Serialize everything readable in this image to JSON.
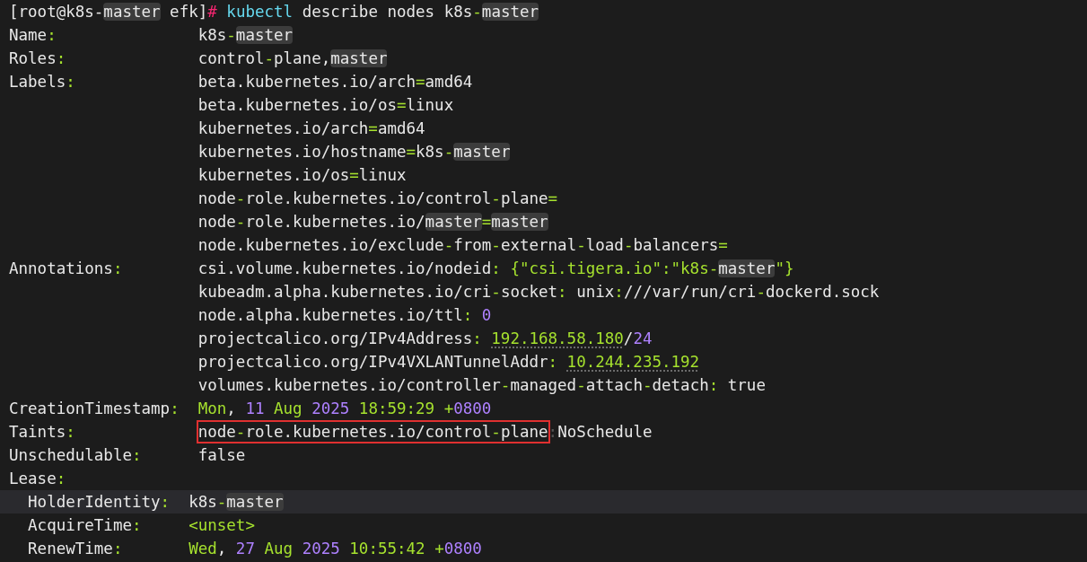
{
  "prompt": [
    {
      "text": "[root@k8s-",
      "kind": "plain"
    },
    {
      "text": "master",
      "kind": "match"
    },
    {
      "text": " efk]",
      "kind": "plain"
    },
    {
      "text": "#",
      "kind": "sign"
    },
    {
      "text": " kubectl",
      "kind": "command"
    },
    {
      "text": " describe nodes k8s",
      "kind": "plain"
    },
    {
      "text": "-",
      "kind": "punct"
    },
    {
      "text": "master",
      "kind": "match"
    }
  ],
  "lines": [
    {
      "current": false,
      "key": [
        {
          "text": "Name",
          "kind": "plain"
        },
        {
          "text": ":",
          "kind": "punct"
        }
      ],
      "value": [
        {
          "text": "k8s",
          "kind": "plain"
        },
        {
          "text": "-",
          "kind": "punct"
        },
        {
          "text": "master",
          "kind": "match"
        }
      ]
    },
    {
      "current": false,
      "key": [
        {
          "text": "Roles",
          "kind": "plain"
        },
        {
          "text": ":",
          "kind": "punct"
        }
      ],
      "value": [
        {
          "text": "control",
          "kind": "plain"
        },
        {
          "text": "-",
          "kind": "punct"
        },
        {
          "text": "plane,",
          "kind": "plain"
        },
        {
          "text": "master",
          "kind": "match"
        }
      ]
    },
    {
      "current": false,
      "key": [
        {
          "text": "Labels",
          "kind": "plain"
        },
        {
          "text": ":",
          "kind": "punct"
        }
      ],
      "value": [
        {
          "text": "beta.kubernetes.io/arch",
          "kind": "plain"
        },
        {
          "text": "=",
          "kind": "punct"
        },
        {
          "text": "amd64",
          "kind": "plain"
        }
      ]
    },
    {
      "current": false,
      "value": [
        {
          "text": "beta.kubernetes.io/os",
          "kind": "plain"
        },
        {
          "text": "=",
          "kind": "punct"
        },
        {
          "text": "linux",
          "kind": "plain"
        }
      ]
    },
    {
      "current": false,
      "value": [
        {
          "text": "kubernetes.io/arch",
          "kind": "plain"
        },
        {
          "text": "=",
          "kind": "punct"
        },
        {
          "text": "amd64",
          "kind": "plain"
        }
      ]
    },
    {
      "current": false,
      "value": [
        {
          "text": "kubernetes.io/hostname",
          "kind": "plain"
        },
        {
          "text": "=",
          "kind": "punct"
        },
        {
          "text": "k8s",
          "kind": "plain"
        },
        {
          "text": "-",
          "kind": "punct"
        },
        {
          "text": "master",
          "kind": "match"
        }
      ]
    },
    {
      "current": false,
      "value": [
        {
          "text": "kubernetes.io/os",
          "kind": "plain"
        },
        {
          "text": "=",
          "kind": "punct"
        },
        {
          "text": "linux",
          "kind": "plain"
        }
      ]
    },
    {
      "current": false,
      "value": [
        {
          "text": "node",
          "kind": "plain"
        },
        {
          "text": "-",
          "kind": "punct"
        },
        {
          "text": "role.kubernetes.io/control",
          "kind": "plain"
        },
        {
          "text": "-",
          "kind": "punct"
        },
        {
          "text": "plane",
          "kind": "plain"
        },
        {
          "text": "=",
          "kind": "punct"
        }
      ]
    },
    {
      "current": false,
      "value": [
        {
          "text": "node",
          "kind": "plain"
        },
        {
          "text": "-",
          "kind": "punct"
        },
        {
          "text": "role.kubernetes.io/",
          "kind": "plain"
        },
        {
          "text": "master",
          "kind": "match"
        },
        {
          "text": "=",
          "kind": "punct"
        },
        {
          "text": "master",
          "kind": "match"
        }
      ]
    },
    {
      "current": false,
      "value": [
        {
          "text": "node.kubernetes.io/exclude",
          "kind": "plain"
        },
        {
          "text": "-",
          "kind": "punct"
        },
        {
          "text": "from",
          "kind": "plain"
        },
        {
          "text": "-",
          "kind": "punct"
        },
        {
          "text": "external",
          "kind": "plain"
        },
        {
          "text": "-",
          "kind": "punct"
        },
        {
          "text": "load",
          "kind": "plain"
        },
        {
          "text": "-",
          "kind": "punct"
        },
        {
          "text": "balancers",
          "kind": "plain"
        },
        {
          "text": "=",
          "kind": "punct"
        }
      ]
    },
    {
      "current": false,
      "key": [
        {
          "text": "Annotations",
          "kind": "plain"
        },
        {
          "text": ":",
          "kind": "punct"
        }
      ],
      "value": [
        {
          "text": "csi.volume.kubernetes.io/nodeid",
          "kind": "plain"
        },
        {
          "text": ":",
          "kind": "punct"
        },
        {
          "text": " {\"csi.tigera.io\":\"k8s",
          "kind": "string"
        },
        {
          "text": "-",
          "kind": "punct"
        },
        {
          "text": "master",
          "kind": "match"
        },
        {
          "text": "\"}",
          "kind": "string"
        }
      ]
    },
    {
      "current": false,
      "value": [
        {
          "text": "kubeadm.alpha.kubernetes.io/cri",
          "kind": "plain"
        },
        {
          "text": "-",
          "kind": "punct"
        },
        {
          "text": "socket",
          "kind": "plain"
        },
        {
          "text": ":",
          "kind": "punct"
        },
        {
          "text": " unix",
          "kind": "plain"
        },
        {
          "text": ":",
          "kind": "punct"
        },
        {
          "text": "///var/run/cri",
          "kind": "plain"
        },
        {
          "text": "-",
          "kind": "punct"
        },
        {
          "text": "dockerd.sock",
          "kind": "plain"
        }
      ]
    },
    {
      "current": false,
      "value": [
        {
          "text": "node.alpha.kubernetes.io/ttl",
          "kind": "plain"
        },
        {
          "text": ":",
          "kind": "punct"
        },
        {
          "text": " 0",
          "kind": "number"
        }
      ]
    },
    {
      "current": false,
      "value": [
        {
          "text": "projectcalico.org/IPv4Address",
          "kind": "plain"
        },
        {
          "text": ": ",
          "kind": "punct"
        },
        {
          "text": "192.168.58.180",
          "kind": "address"
        },
        {
          "text": "/",
          "kind": "plain"
        },
        {
          "text": "24",
          "kind": "number"
        }
      ]
    },
    {
      "current": false,
      "value": [
        {
          "text": "projectcalico.org/IPv4VXLANTunnelAddr",
          "kind": "plain"
        },
        {
          "text": ": ",
          "kind": "punct"
        },
        {
          "text": "10.244.235.192",
          "kind": "address"
        }
      ]
    },
    {
      "current": false,
      "value": [
        {
          "text": "volumes.kubernetes.io/controller",
          "kind": "plain"
        },
        {
          "text": "-",
          "kind": "punct"
        },
        {
          "text": "managed",
          "kind": "plain"
        },
        {
          "text": "-",
          "kind": "punct"
        },
        {
          "text": "attach",
          "kind": "plain"
        },
        {
          "text": "-",
          "kind": "punct"
        },
        {
          "text": "detach",
          "kind": "plain"
        },
        {
          "text": ":",
          "kind": "punct"
        },
        {
          "text": " true",
          "kind": "plain"
        }
      ]
    },
    {
      "current": false,
      "key": [
        {
          "text": "CreationTimestamp",
          "kind": "plain"
        },
        {
          "text": ":",
          "kind": "punct"
        }
      ],
      "value": [
        {
          "text": "Mon",
          "kind": "string"
        },
        {
          "text": ", ",
          "kind": "plain"
        },
        {
          "text": "11",
          "kind": "number"
        },
        {
          "text": " Aug ",
          "kind": "string"
        },
        {
          "text": "2025",
          "kind": "number"
        },
        {
          "text": " 18:59:29 +",
          "kind": "string"
        },
        {
          "text": "0800",
          "kind": "number"
        }
      ]
    },
    {
      "current": false,
      "key": [
        {
          "text": "Taints",
          "kind": "plain"
        },
        {
          "text": ":",
          "kind": "punct"
        }
      ],
      "outlined": [
        {
          "text": "node",
          "kind": "plain"
        },
        {
          "text": "-",
          "kind": "punct"
        },
        {
          "text": "role.kubernetes.io/control",
          "kind": "plain"
        },
        {
          "text": "-",
          "kind": "punct"
        },
        {
          "text": "plane",
          "kind": "plain"
        }
      ],
      "value": [
        {
          "text": ":",
          "kind": "dim"
        },
        {
          "text": "NoSchedule",
          "kind": "plain"
        }
      ]
    },
    {
      "current": false,
      "key": [
        {
          "text": "Unschedulable",
          "kind": "plain"
        },
        {
          "text": ":",
          "kind": "punct"
        }
      ],
      "value": [
        {
          "text": "false",
          "kind": "plain"
        }
      ]
    },
    {
      "current": false,
      "key": [
        {
          "text": "Lease",
          "kind": "plain"
        },
        {
          "text": ":",
          "kind": "punct"
        }
      ],
      "children": [
        {
          "current": true,
          "key": [
            {
              "text": "HolderIdentity",
              "kind": "plain"
            },
            {
              "text": ":",
              "kind": "punct"
            }
          ],
          "value": [
            {
              "text": "k8s",
              "kind": "plain"
            },
            {
              "text": "-",
              "kind": "punct"
            },
            {
              "text": "master",
              "kind": "match"
            }
          ]
        },
        {
          "current": false,
          "key": [
            {
              "text": "AcquireTime",
              "kind": "plain"
            },
            {
              "text": ":",
              "kind": "punct"
            }
          ],
          "value": [
            {
              "text": "<unset>",
              "kind": "string"
            }
          ]
        },
        {
          "current": false,
          "key": [
            {
              "text": "RenewTime",
              "kind": "plain"
            },
            {
              "text": ":",
              "kind": "punct"
            }
          ],
          "value": [
            {
              "text": "Wed",
              "kind": "string"
            },
            {
              "text": ", ",
              "kind": "plain"
            },
            {
              "text": "27",
              "kind": "number"
            },
            {
              "text": " Aug ",
              "kind": "string"
            },
            {
              "text": "2025",
              "kind": "number"
            },
            {
              "text": " 10:55:42 +",
              "kind": "string"
            },
            {
              "text": "0800",
              "kind": "number"
            }
          ]
        }
      ]
    }
  ]
}
